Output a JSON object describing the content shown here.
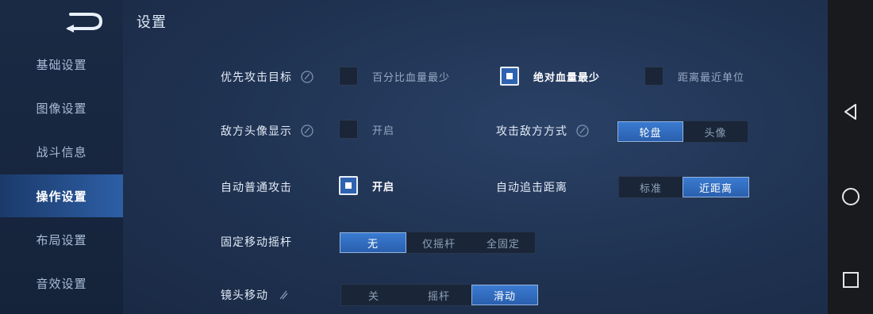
{
  "page_title": "设置",
  "sidebar": {
    "back_icon": "back-arrow-icon",
    "items": [
      {
        "label": "基础设置"
      },
      {
        "label": "图像设置"
      },
      {
        "label": "战斗信息"
      },
      {
        "label": "操作设置",
        "active": true
      },
      {
        "label": "布局设置"
      },
      {
        "label": "音效设置"
      }
    ]
  },
  "settings": {
    "target_priority": {
      "label": "优先攻击目标",
      "options": [
        {
          "label": "百分比血量最少",
          "checked": false
        },
        {
          "label": "绝对血量最少",
          "checked": true
        },
        {
          "label": "距离最近单位",
          "checked": false
        }
      ]
    },
    "enemy_avatar": {
      "label": "敌方头像显示",
      "option": {
        "label": "开启",
        "checked": false
      }
    },
    "attack_enemy_mode": {
      "label": "攻击敌方方式",
      "options": [
        {
          "label": "轮盘",
          "selected": true
        },
        {
          "label": "头像",
          "selected": false
        }
      ]
    },
    "auto_attack": {
      "label": "自动普通攻击",
      "option": {
        "label": "开启",
        "checked": true
      }
    },
    "auto_chase": {
      "label": "自动追击距离",
      "options": [
        {
          "label": "标准",
          "selected": false
        },
        {
          "label": "近距离",
          "selected": true
        }
      ]
    },
    "fixed_joystick": {
      "label": "固定移动摇杆",
      "options": [
        {
          "label": "无",
          "selected": true
        },
        {
          "label": "仅摇杆",
          "selected": false
        },
        {
          "label": "全固定",
          "selected": false
        }
      ]
    },
    "camera_move": {
      "label": "镜头移动",
      "options": [
        {
          "label": "关",
          "selected": false
        },
        {
          "label": "摇杆",
          "selected": false
        },
        {
          "label": "滑动",
          "selected": true
        }
      ]
    }
  },
  "system_nav": {
    "back": "back-triangle-icon",
    "home": "home-circle-icon",
    "recents": "recents-square-icon"
  },
  "colors": {
    "accent": "#2f63b0",
    "sidebar_bg": "#1a2a44",
    "main_bg": "#1f3251",
    "nav_bar_bg": "#181a1e"
  }
}
